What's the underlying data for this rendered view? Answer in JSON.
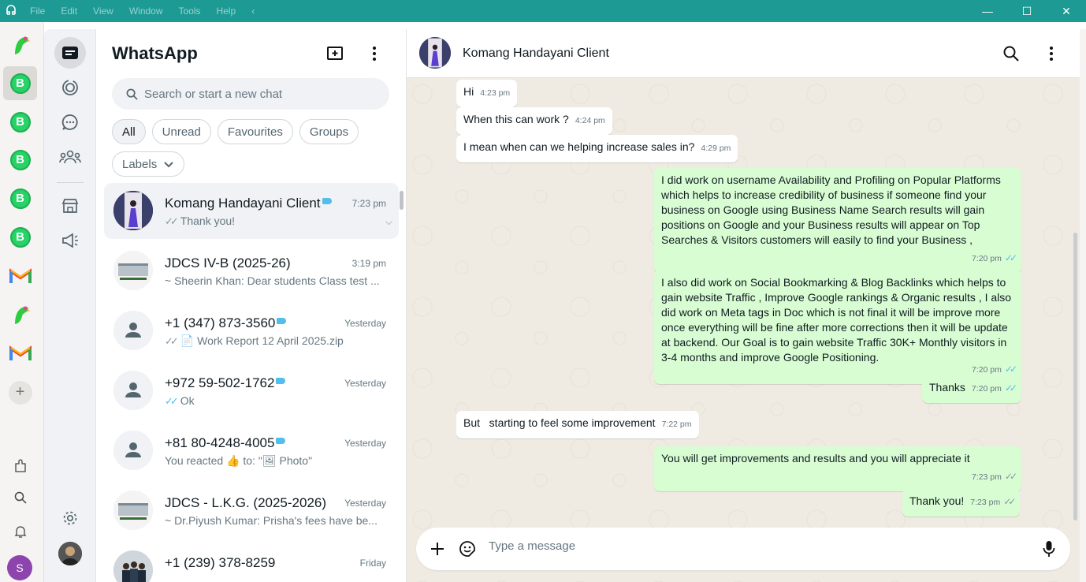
{
  "window": {
    "menu": [
      "File",
      "Edit",
      "View",
      "Window",
      "Tools",
      "Help"
    ],
    "back_glyph": "‹",
    "controls": [
      "—",
      "☐",
      "✕"
    ]
  },
  "rail": {
    "accounts": [
      {
        "type": "parrot-app",
        "active": false
      },
      {
        "type": "whatsapp-business",
        "label": "B",
        "active": true
      },
      {
        "type": "whatsapp-business",
        "label": "B",
        "active": false
      },
      {
        "type": "whatsapp-business",
        "label": "B",
        "active": false
      },
      {
        "type": "whatsapp-business",
        "label": "B",
        "active": false
      },
      {
        "type": "whatsapp-business",
        "label": "B",
        "active": false
      },
      {
        "type": "gmail",
        "active": false
      },
      {
        "type": "parrot-app",
        "active": false
      },
      {
        "type": "gmail",
        "active": false
      }
    ],
    "add_label": "+",
    "profile_initial": "S"
  },
  "list": {
    "title": "WhatsApp",
    "search_placeholder": "Search or start a new chat",
    "filters": [
      "All",
      "Unread",
      "Favourites",
      "Groups"
    ],
    "labels_chip": "Labels",
    "chats": [
      {
        "name": "Komang Handayani Client",
        "time": "7:23 pm",
        "preview": "Thank you!",
        "ticks": "grey",
        "tag": true,
        "selected": true,
        "avatar": "photo-dark"
      },
      {
        "name": "JDCS IV-B (2025-26)",
        "time": "3:19 pm",
        "preview": "~ Sheerin Khan: Dear students Class test ...",
        "ticks": "",
        "tag": false,
        "selected": false,
        "avatar": "school"
      },
      {
        "name": "+1 (347) 873-3560",
        "time": "Yesterday",
        "preview": "📄 Work Report 12 April 2025.zip",
        "ticks": "grey",
        "tag": true,
        "selected": false,
        "avatar": "default"
      },
      {
        "name": "+972 59-502-1762",
        "time": "Yesterday",
        "preview": "Ok",
        "ticks": "read",
        "tag": true,
        "selected": false,
        "avatar": "default"
      },
      {
        "name": "+81 80-4248-4005",
        "time": "Yesterday",
        "preview": "You reacted 👍 to: \"🖼 Photo\"",
        "ticks": "",
        "tag": true,
        "selected": false,
        "avatar": "default"
      },
      {
        "name": "JDCS - L.K.G. (2025-2026)",
        "time": "Yesterday",
        "preview": "~ Dr.Piyush Kumar: Prisha's fees have be...",
        "ticks": "",
        "tag": false,
        "selected": false,
        "avatar": "school"
      },
      {
        "name": "+1 (239) 378-8259",
        "time": "Friday",
        "preview": "",
        "ticks": "",
        "tag": false,
        "selected": false,
        "avatar": "group-photo"
      }
    ]
  },
  "conversation": {
    "contact": "Komang Handayani Client",
    "composer_placeholder": "Type a message",
    "messages": [
      {
        "dir": "in",
        "text": "Hi",
        "time": "4:23 pm"
      },
      {
        "dir": "in",
        "text": "When this can work ?",
        "time": "4:24 pm"
      },
      {
        "dir": "in",
        "text": "I mean when can we helping increase sales in?",
        "time": "4:29 pm"
      },
      {
        "dir": "out",
        "text": "I did work on username Availability and Profiling on Popular Platforms which helps to increase credibility of business if someone find your business on Google using Business Name Search results will gain positions on Google and your Business results will appear on Top Searches & Visitors customers will easily to find your Business ,",
        "time": "7:20 pm",
        "ticks": "read"
      },
      {
        "dir": "out",
        "text": "I also did work on Social Bookmarking & Blog Backlinks which helps to gain website Traffic , Improve Google rankings & Organic results , I also did work on Meta tags in Doc which is not final it will be improve more once everything will be fine after more corrections then it will be update at backend. Our Goal is to gain website Traffic 30K+ Monthly visitors in 3-4 months and improve Google Positioning.",
        "time": "7:20 pm",
        "ticks": "read"
      },
      {
        "dir": "out",
        "text": "Thanks",
        "time": "7:20 pm",
        "ticks": "read"
      },
      {
        "dir": "in",
        "text": "But   starting to feel some improvement",
        "time": "7:22 pm"
      },
      {
        "dir": "out",
        "text": "You will get improvements and results and you will appreciate it",
        "time": "7:23 pm",
        "ticks": "grey"
      },
      {
        "dir": "out",
        "text": "Thank you!",
        "time": "7:23 pm",
        "ticks": "grey"
      }
    ]
  },
  "colors": {
    "titlebar": "#1d9a94",
    "outgoing_bubble": "#d9fdd3",
    "incoming_bubble": "#ffffff",
    "read_tick": "#53bdeb",
    "label_tag": "#53bdeb"
  }
}
